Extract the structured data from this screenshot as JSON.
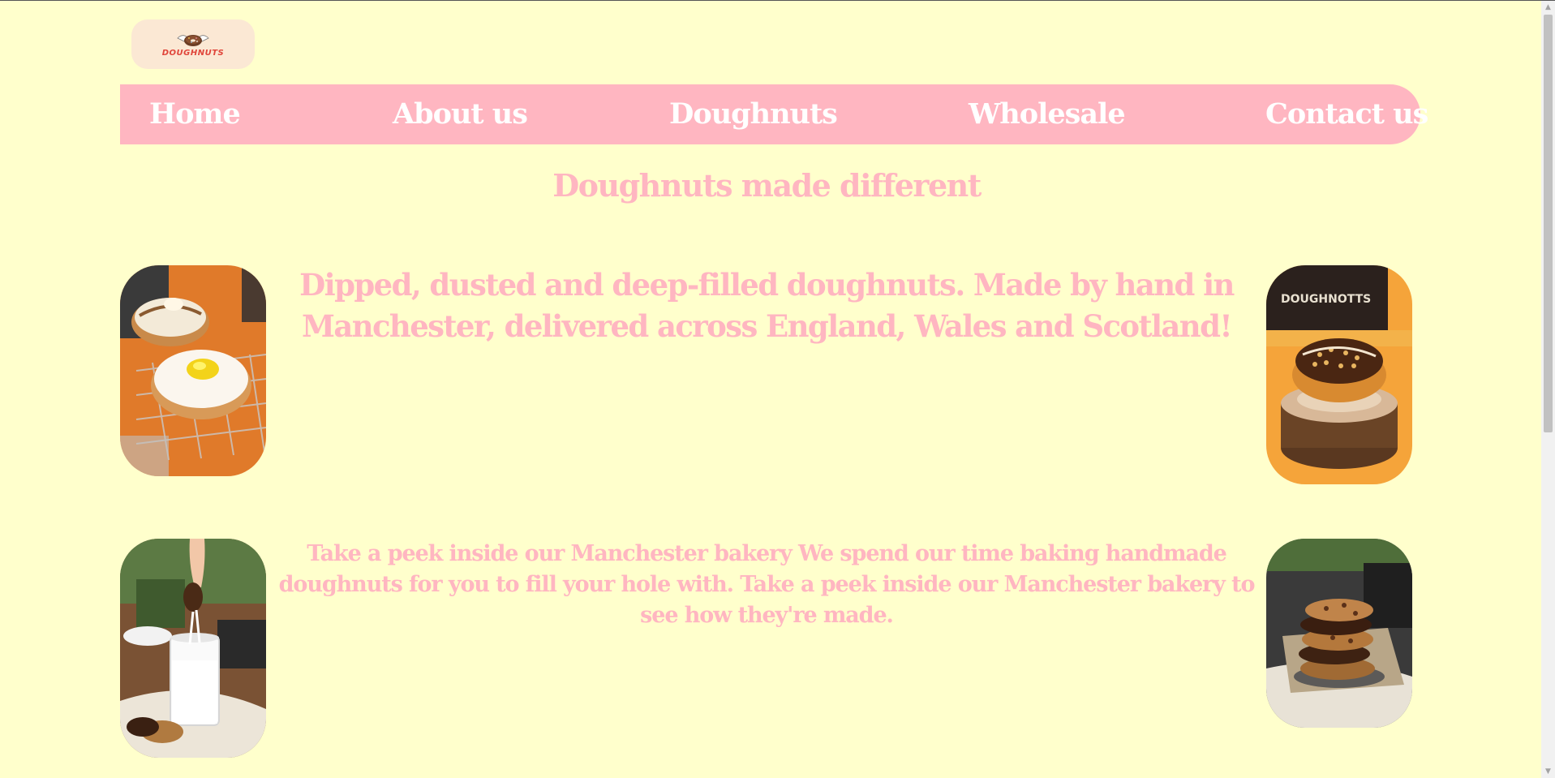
{
  "logo": {
    "text": "DOUGHNUTS"
  },
  "nav": {
    "items": [
      {
        "label": "Home"
      },
      {
        "label": "About us"
      },
      {
        "label": "Doughnuts"
      },
      {
        "label": "Wholesale"
      },
      {
        "label": "Contact us"
      }
    ]
  },
  "hero": {
    "tagline": "Doughnuts made different",
    "intro": "Dipped, dusted and deep-filled doughnuts. Made by hand in Manchester, delivered across England, Wales and Scotland!"
  },
  "bakery": {
    "text": "Take a peek inside our Manchester bakery We spend our time baking handmade doughnuts for you to fill your hole with. Take a peek inside our Manchester bakery to see how they're made."
  },
  "colors": {
    "background": "#ffffcc",
    "nav_bg": "#ffb6c1",
    "nav_text": "#ffffff",
    "heading_text": "#ffb6c1"
  },
  "icons": {
    "scroll_up": "triangle-up-icon",
    "scroll_down": "triangle-down-icon"
  }
}
